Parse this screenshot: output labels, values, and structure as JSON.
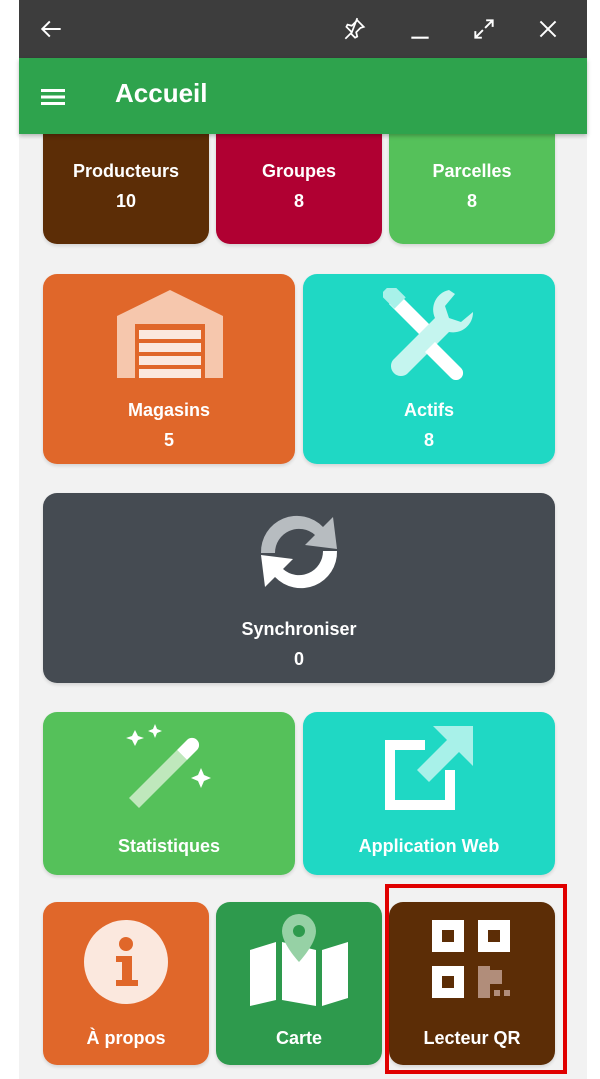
{
  "window_bar": {
    "back_icon": "arrow-left-icon",
    "pin_icon": "pin-icon",
    "minimize_icon": "minimize-icon",
    "expand_icon": "expand-icon",
    "close_icon": "close-icon"
  },
  "appbar": {
    "menu_icon": "hamburger-menu-icon",
    "title": "Accueil"
  },
  "tiles": {
    "producteurs": {
      "label": "Producteurs",
      "count": "10",
      "color": "#5c2d06",
      "icon": "people-icon"
    },
    "groupes": {
      "label": "Groupes",
      "count": "8",
      "color": "#b00032",
      "icon": "group-icon"
    },
    "parcelles": {
      "label": "Parcelles",
      "count": "8",
      "color": "#55c15a",
      "icon": "field-icon"
    },
    "magasins": {
      "label": "Magasins",
      "count": "5",
      "color": "#e0672a",
      "icon": "warehouse-icon"
    },
    "actifs": {
      "label": "Actifs",
      "count": "8",
      "color": "#1fd8c4",
      "icon": "tools-icon"
    },
    "synchroniser": {
      "label": "Synchroniser",
      "count": "0",
      "color": "#454b52",
      "icon": "sync-icon"
    },
    "statistiques": {
      "label": "Statistiques",
      "color": "#55c15a",
      "icon": "magic-wand-icon"
    },
    "application_web": {
      "label": "Application Web",
      "color": "#1fd8c4",
      "icon": "external-link-icon"
    },
    "a_propos": {
      "label": "À propos",
      "color": "#e0672a",
      "icon": "info-icon"
    },
    "carte": {
      "label": "Carte",
      "color": "#2e9a4d",
      "icon": "map-icon"
    },
    "lecteur_qr": {
      "label": "Lecteur QR",
      "color": "#5c2d06",
      "icon": "qr-code-icon"
    }
  },
  "highlight_color": "#e00000"
}
